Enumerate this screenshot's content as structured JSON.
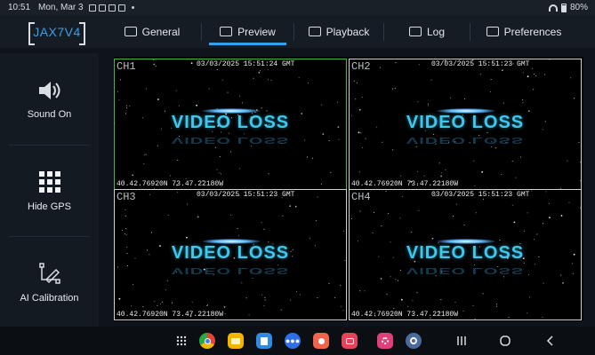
{
  "status_bar": {
    "time": "10:51",
    "date": "Mon, Mar 3",
    "battery": "80%"
  },
  "header": {
    "logo": "JAX7V4",
    "tabs": [
      {
        "label": "General",
        "icon": "general-icon"
      },
      {
        "label": "Preview",
        "icon": "preview-icon",
        "active": true
      },
      {
        "label": "Playback",
        "icon": "playback-icon"
      },
      {
        "label": "Log",
        "icon": "log-icon"
      },
      {
        "label": "Preferences",
        "icon": "preferences-icon"
      }
    ],
    "accent_color": "#3aa0e6"
  },
  "sidebar": {
    "items": [
      {
        "label": "Sound On",
        "icon": "speaker-icon"
      },
      {
        "label": "Hide GPS",
        "icon": "grid-icon"
      },
      {
        "label": "AI Calibration",
        "icon": "pen-icon"
      }
    ]
  },
  "channels": [
    {
      "label": "CH1",
      "timestamp": "03/03/2025 15:51:24 GMT",
      "status": "VIDEO LOSS",
      "gps": "40.42.76920N 73.47.22180W",
      "selected": true
    },
    {
      "label": "CH2",
      "timestamp": "03/03/2025 15:51:23 GMT",
      "status": "VIDEO LOSS",
      "gps": "40.42.76920N 73.47.22180W",
      "selected": false
    },
    {
      "label": "CH3",
      "timestamp": "03/03/2025 15:51:23 GMT",
      "status": "VIDEO LOSS",
      "gps": "40.42.76920N 73.47.22180W",
      "selected": false
    },
    {
      "label": "CH4",
      "timestamp": "03/03/2025 15:51:23 GMT",
      "status": "VIDEO LOSS",
      "gps": "40.42.76920N 73.47.22180W",
      "selected": false
    }
  ],
  "colors": {
    "selected_border": "#3bbd3b",
    "video_loss_text": "#3ec8ee"
  },
  "navbar": {
    "apps": [
      {
        "name": "app-drawer-icon",
        "color": "#0b0f13"
      },
      {
        "name": "chrome-icon",
        "color": "#e84435"
      },
      {
        "name": "files-icon",
        "color": "#f5b400"
      },
      {
        "name": "calendar-icon",
        "color": "#2f8be6"
      },
      {
        "name": "messages-icon",
        "color": "#2f6fe6"
      },
      {
        "name": "contacts-icon",
        "color": "#f0644b"
      },
      {
        "name": "screen-recorder-icon",
        "color": "#e0455a"
      },
      {
        "name": "bixby-icon",
        "color": "#e0407a"
      },
      {
        "name": "settings-icon",
        "color": "#4a6a9a"
      }
    ]
  }
}
